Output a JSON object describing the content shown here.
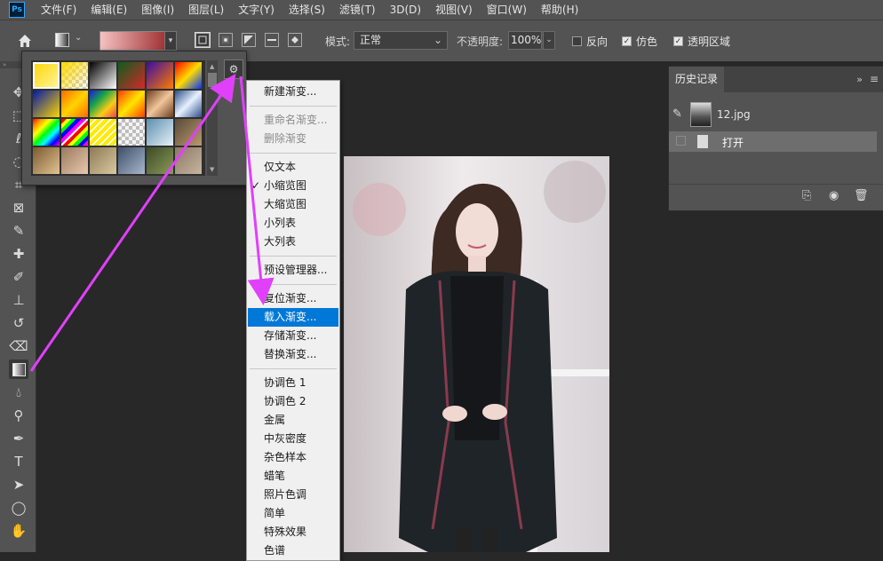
{
  "app": {
    "logo": "Ps"
  },
  "menubar": {
    "items": [
      "文件(F)",
      "编辑(E)",
      "图像(I)",
      "图层(L)",
      "文字(Y)",
      "选择(S)",
      "滤镜(T)",
      "3D(D)",
      "视图(V)",
      "窗口(W)",
      "帮助(H)"
    ]
  },
  "options": {
    "mode_label": "模式:",
    "mode_value": "正常",
    "opacity_label": "不透明度:",
    "opacity_value": "100%",
    "reverse_label": "反向",
    "reverse_checked": false,
    "dither_label": "仿色",
    "dither_checked": true,
    "transparency_label": "透明区域",
    "transparency_checked": true,
    "gradient_colors": [
      "#f6c2c2",
      "#a23538"
    ]
  },
  "gradient_swatches": [
    "linear-gradient(135deg,#ffd400,#fff6a0)",
    "linear-gradient(135deg,#ffd800 0%,rgba(255,216,0,0) 100%),repeating-conic-gradient(#ccc 0 25%,#fff 0 50%) 0 0/8px 8px",
    "linear-gradient(135deg,#000,#fff)",
    "linear-gradient(135deg,#0b5d1e,#d62828)",
    "linear-gradient(135deg,#3a0ca3,#ff7b00)",
    "linear-gradient(135deg,#ff0000,#ffdd00,#0033ff)",
    "linear-gradient(135deg,#0018a8,#ffd400)",
    "linear-gradient(135deg,#ff6a00,#ffd400,#ff6a00)",
    "linear-gradient(135deg,#1b1bd8,#16a34a,#facc15,#ef4444)",
    "linear-gradient(135deg,#ff3d00,#ffe600,#ff3d00)",
    "linear-gradient(135deg,#6b3e1f,#f2c59a,#6b3e1f)",
    "linear-gradient(135deg,#2b4f86,#e8f0ff,#2b4f86)",
    "linear-gradient(135deg,#ff0000,#ff9900,#ffff00,#00ff00,#00ffff,#0000ff,#ff00ff)",
    "repeating-linear-gradient(135deg,#ff0000 0 4px,#ffff00 4px 8px,#00ff00 8px 12px,#0000ff 12px 16px,#ff00ff 16px 20px,#fff 20px 22px)",
    "repeating-linear-gradient(135deg,#ffea00 0 4px,#fff 4px 6px)",
    "repeating-conic-gradient(#bdbdbd 0 25%,#f4f4f4 0 50%) 0 0/8px 8px",
    "linear-gradient(135deg,#5b8fb0,#e8f2f6)",
    "linear-gradient(135deg,#5a4a3a,#b99a6a)",
    "linear-gradient(135deg,#7a5a32,#e3c48f)",
    "linear-gradient(135deg,#9b7a5e,#e8c9b0)",
    "linear-gradient(135deg,#8c7a56,#d9c9a0)",
    "linear-gradient(135deg,#3d4f6b,#a9b7cc)",
    "linear-gradient(135deg,#3c4a25,#8a9a5a)",
    "linear-gradient(135deg,#8d7865,#c7b5a0)"
  ],
  "context_menu": {
    "items": [
      {
        "label": "新建渐变...",
        "state": "normal"
      },
      {
        "label": "",
        "state": "separator"
      },
      {
        "label": "重命名渐变...",
        "state": "disabled"
      },
      {
        "label": "删除渐变",
        "state": "disabled"
      },
      {
        "label": "",
        "state": "separator"
      },
      {
        "label": "仅文本",
        "state": "normal"
      },
      {
        "label": "小缩览图",
        "state": "checked"
      },
      {
        "label": "大缩览图",
        "state": "normal"
      },
      {
        "label": "小列表",
        "state": "normal"
      },
      {
        "label": "大列表",
        "state": "normal"
      },
      {
        "label": "",
        "state": "separator"
      },
      {
        "label": "预设管理器...",
        "state": "normal"
      },
      {
        "label": "",
        "state": "separator"
      },
      {
        "label": "复位渐变...",
        "state": "normal"
      },
      {
        "label": "载入渐变...",
        "state": "highlighted"
      },
      {
        "label": "存储渐变...",
        "state": "normal"
      },
      {
        "label": "替换渐变...",
        "state": "normal"
      },
      {
        "label": "",
        "state": "separator"
      },
      {
        "label": "协调色 1",
        "state": "normal"
      },
      {
        "label": "协调色 2",
        "state": "normal"
      },
      {
        "label": "金属",
        "state": "normal"
      },
      {
        "label": "中灰密度",
        "state": "normal"
      },
      {
        "label": "杂色样本",
        "state": "normal"
      },
      {
        "label": "蜡笔",
        "state": "normal"
      },
      {
        "label": "照片色调",
        "state": "normal"
      },
      {
        "label": "简单",
        "state": "normal"
      },
      {
        "label": "特殊效果",
        "state": "normal"
      },
      {
        "label": "色谱",
        "state": "normal"
      }
    ]
  },
  "history": {
    "tab_label": "历史记录",
    "collapse_icon": "»",
    "menu_icon": "≡",
    "snapshot_label": "12.jpg",
    "state_label": "打开"
  },
  "annotation_color": "#e040fb"
}
